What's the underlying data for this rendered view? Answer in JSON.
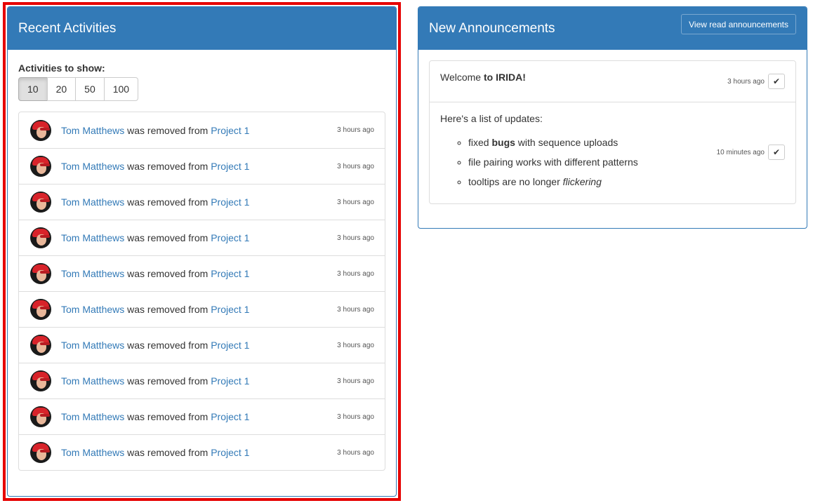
{
  "activities_panel": {
    "title": "Recent Activities",
    "filter_label": "Activities to show:",
    "filter_options": [
      "10",
      "20",
      "50",
      "100"
    ],
    "selected_option": "10",
    "items": [
      {
        "user": "Tom Matthews",
        "action": "was removed from",
        "project": "Project 1",
        "time": "3 hours ago"
      },
      {
        "user": "Tom Matthews",
        "action": "was removed from",
        "project": "Project 1",
        "time": "3 hours ago"
      },
      {
        "user": "Tom Matthews",
        "action": "was removed from",
        "project": "Project 1",
        "time": "3 hours ago"
      },
      {
        "user": "Tom Matthews",
        "action": "was removed from",
        "project": "Project 1",
        "time": "3 hours ago"
      },
      {
        "user": "Tom Matthews",
        "action": "was removed from",
        "project": "Project 1",
        "time": "3 hours ago"
      },
      {
        "user": "Tom Matthews",
        "action": "was removed from",
        "project": "Project 1",
        "time": "3 hours ago"
      },
      {
        "user": "Tom Matthews",
        "action": "was removed from",
        "project": "Project 1",
        "time": "3 hours ago"
      },
      {
        "user": "Tom Matthews",
        "action": "was removed from",
        "project": "Project 1",
        "time": "3 hours ago"
      },
      {
        "user": "Tom Matthews",
        "action": "was removed from",
        "project": "Project 1",
        "time": "3 hours ago"
      },
      {
        "user": "Tom Matthews",
        "action": "was removed from",
        "project": "Project 1",
        "time": "3 hours ago"
      }
    ]
  },
  "announcements_panel": {
    "title": "New Announcements",
    "view_read_label": "View read announcements",
    "announcement": {
      "title_prefix": "Welcome ",
      "title_bold": "to IRIDA!",
      "time": "3 hours ago",
      "intro": "Here's a list of updates:",
      "time_body": "10 minutes ago",
      "items": [
        {
          "before": "fixed ",
          "bold": "bugs",
          "after": " with sequence uploads"
        },
        {
          "text": "file pairing works with different patterns"
        },
        {
          "before": "tooltips are no longer ",
          "italic": "flickering"
        }
      ]
    }
  },
  "colors": {
    "primary": "#337ab7",
    "highlight": "#e60000"
  },
  "icons": {
    "check": "checkmark-icon",
    "avatar": "user-avatar"
  }
}
